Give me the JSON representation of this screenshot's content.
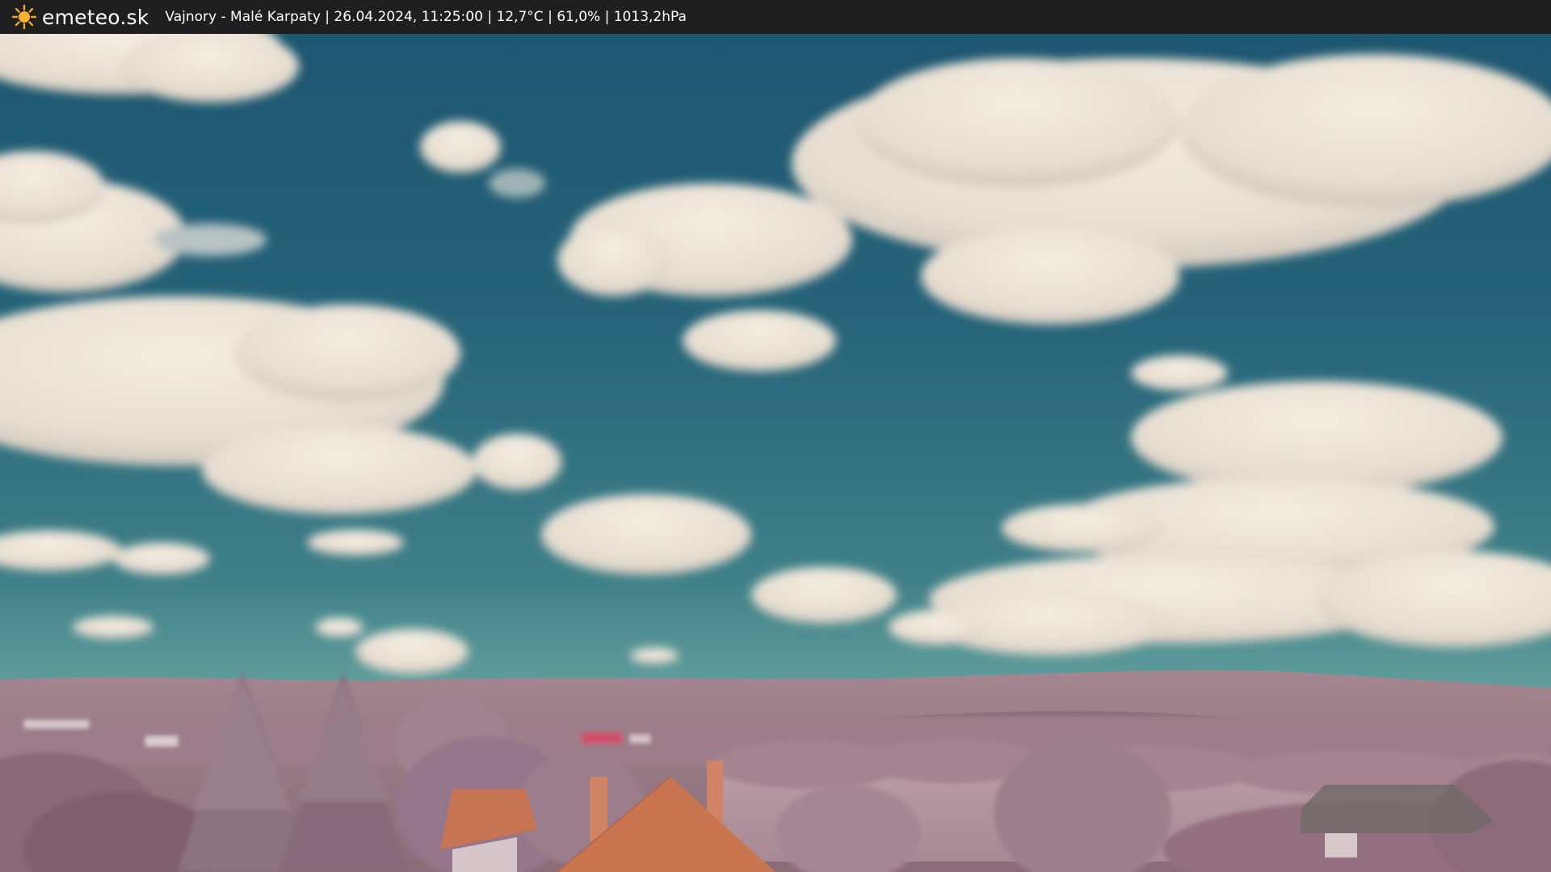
{
  "header": {
    "site_name": "emeteo.sk",
    "logo_icon": "sun-icon",
    "caption": "Vajnory - Malé Karpaty | 26.04.2024, 11:25:00 | 12,7°C | 61,0% | 1013,2hPa"
  },
  "colors": {
    "bar_background": "#1f1f1f",
    "sky_top": "#1f5b72",
    "sky_horizon": "#5d9a9b",
    "cloud": "#ece4d8",
    "vegetation": "#a9828f",
    "roof": "#c57654"
  }
}
